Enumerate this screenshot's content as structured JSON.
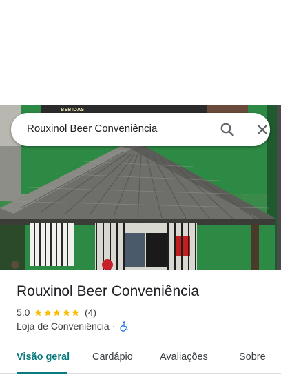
{
  "search": {
    "query": "Rouxinol Beer Conveniência",
    "search_icon": "search-icon",
    "close_icon": "close-icon"
  },
  "photo": {
    "sign_text": "BEBIDAS"
  },
  "place": {
    "name": "Rouxinol Beer Conveniência",
    "rating": "5,0",
    "stars": 5,
    "review_count": "(4)",
    "category": "Loja de Conveniência",
    "separator": "·",
    "accessibility_icon": "wheelchair-icon"
  },
  "tabs": [
    {
      "label": "Visão geral",
      "active": true
    },
    {
      "label": "Cardápio",
      "active": false
    },
    {
      "label": "Avaliações",
      "active": false
    },
    {
      "label": "Sobre",
      "active": false
    }
  ],
  "colors": {
    "accent": "#0b7a7f",
    "star": "#fbbc04",
    "building_green": "#2f7a3d"
  }
}
